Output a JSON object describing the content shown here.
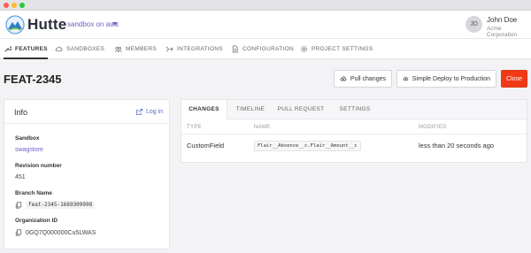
{
  "app": {
    "brand": "Hutte",
    "environment": "sandbox on aws"
  },
  "user": {
    "initials": "JD",
    "name": "John Doe",
    "organization": "Acme Corporation"
  },
  "nav": {
    "items": [
      {
        "label": "FEATURES",
        "icon": "wrench-icon",
        "active": true
      },
      {
        "label": "SANDBOXES",
        "icon": "cloud-icon",
        "active": false
      },
      {
        "label": "MEMBERS",
        "icon": "users-icon",
        "active": false
      },
      {
        "label": "INTEGRATIONS",
        "icon": "integrations-icon",
        "active": false
      },
      {
        "label": "CONFIGURATION",
        "icon": "document-icon",
        "active": false
      },
      {
        "label": "PROJECT SETTINGS",
        "icon": "gear-icon",
        "active": false
      }
    ]
  },
  "page": {
    "title": "FEAT-2345",
    "actions": {
      "pull": "Pull changes",
      "deploy": "Simple Deploy to Production",
      "close": "Close"
    }
  },
  "info": {
    "title": "Info",
    "login": "Log in",
    "sandbox_label": "Sandbox",
    "sandbox_value": "swagstore",
    "revision_label": "Revision number",
    "revision_value": "451",
    "branch_label": "Branch Name",
    "branch_value": "feat-2345-1669309998",
    "org_label": "Organization ID",
    "org_value": "0GQ7Q000000Cu5LWAS"
  },
  "changes": {
    "tabs": [
      "CHANGES",
      "TIMELINE",
      "PULL REQUEST",
      "SETTINGS"
    ],
    "columns": [
      "TYPE",
      "NAME",
      "MODIFIED"
    ],
    "rows": [
      {
        "type": "CustomField",
        "name": "Flair__Absence__c.Flair__Amount__c",
        "modified": "less than 20 seconds ago"
      }
    ]
  },
  "colors": {
    "accent": "#6b63c6",
    "danger": "#f03a17",
    "link": "#5b6bc9"
  }
}
